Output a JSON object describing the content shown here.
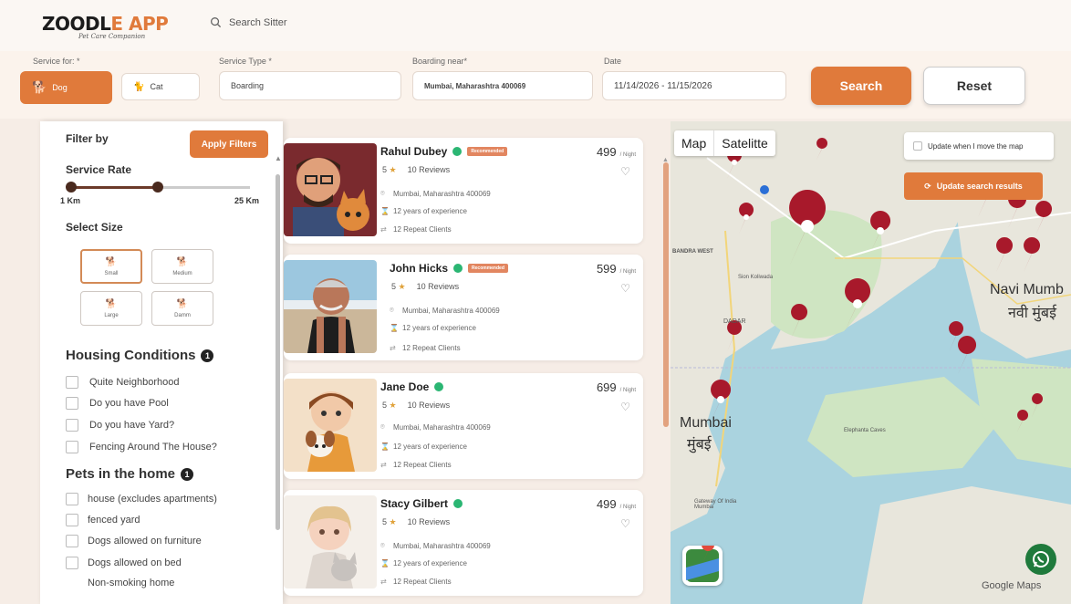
{
  "header": {
    "logo_text_1": "ZOODL",
    "logo_text_2": "E APP",
    "logo_tagline": "Pet Care Companion",
    "search_label": "Search Sitter"
  },
  "form": {
    "service_for_label": "Service for: *",
    "dog": "Dog",
    "cat": "Cat",
    "service_type_label": "Service Type *",
    "service_type_value": "Boarding",
    "boarding_near_label": "Boarding near*",
    "boarding_near_value": "Mumbai, Maharashtra 400069",
    "date_label": "Date",
    "date_value": "11/14/2026 - 11/15/2026",
    "search_btn": "Search",
    "reset_btn": "Reset"
  },
  "filter": {
    "title": "Filter by",
    "apply": "Apply Filters",
    "service_rate": "Service Rate",
    "range_min": "1 Km",
    "range_max": "25 Km",
    "range_value_fraction": 0.49,
    "select_size": "Select Size",
    "sizes": [
      "Small",
      "Medium",
      "Large",
      "Damm"
    ],
    "housing_title": "Housing Conditions",
    "housing_count": "1",
    "housing": [
      "Quite Neighborhood",
      "Do you have Pool",
      "Do you have Yard?",
      "Fencing Around The House?"
    ],
    "pets_title": "Pets in the home",
    "pets_count": "1",
    "pets": [
      "house (excludes apartments)",
      "fenced yard",
      "Dogs allowed on furniture",
      "Dogs allowed on bed",
      "Non-smoking home"
    ]
  },
  "listings": [
    {
      "name": "Rahul Dubey",
      "badge": "Recommended",
      "price": "499",
      "unit": "/ Night",
      "stars": "5",
      "reviews": "10 Reviews",
      "location": "Mumbai, Maharashtra 400069",
      "experience": "12 years of experience",
      "repeat": "12 Repeat Clients"
    },
    {
      "name": "John Hicks",
      "badge": "Recommended",
      "price": "599",
      "unit": "/ Night",
      "stars": "5",
      "reviews": "10 Reviews",
      "location": "Mumbai, Maharashtra 400069",
      "experience": "12 years of experience",
      "repeat": "12 Repeat Clients"
    },
    {
      "name": "Jane Doe",
      "badge": "",
      "price": "699",
      "unit": "/ Night",
      "stars": "5",
      "reviews": "10 Reviews",
      "location": "Mumbai, Maharashtra 400069",
      "experience": "12 years of experience",
      "repeat": "12 Repeat Clients"
    },
    {
      "name": "Stacy Gilbert",
      "badge": "",
      "price": "499",
      "unit": "/ Night",
      "stars": "5",
      "reviews": "10 Reviews",
      "location": "Mumbai, Maharashtra 400069",
      "experience": "12 years of experience",
      "repeat": "12 Repeat Clients"
    }
  ],
  "map": {
    "tab_map": "Map",
    "tab_satellite": "Satelitte",
    "update_move": "Update when I move the map",
    "update_results": "Update search results",
    "labels": [
      "BANDRA WEST",
      "DADAR",
      "Mumbai",
      "मुंबई",
      "Navi Mumb",
      "नवी मुंबई",
      "Elephanta Caves",
      "Gateway Of India Mumbai",
      "Sion Koliwada",
      "Google Maps"
    ],
    "colors": {
      "pin": "#a8192b",
      "water": "#aad3df",
      "land": "#e8e6dc",
      "green": "#cfe5c2"
    }
  },
  "colors": {
    "accent": "#e07a3b",
    "background": "#f6ede6"
  }
}
